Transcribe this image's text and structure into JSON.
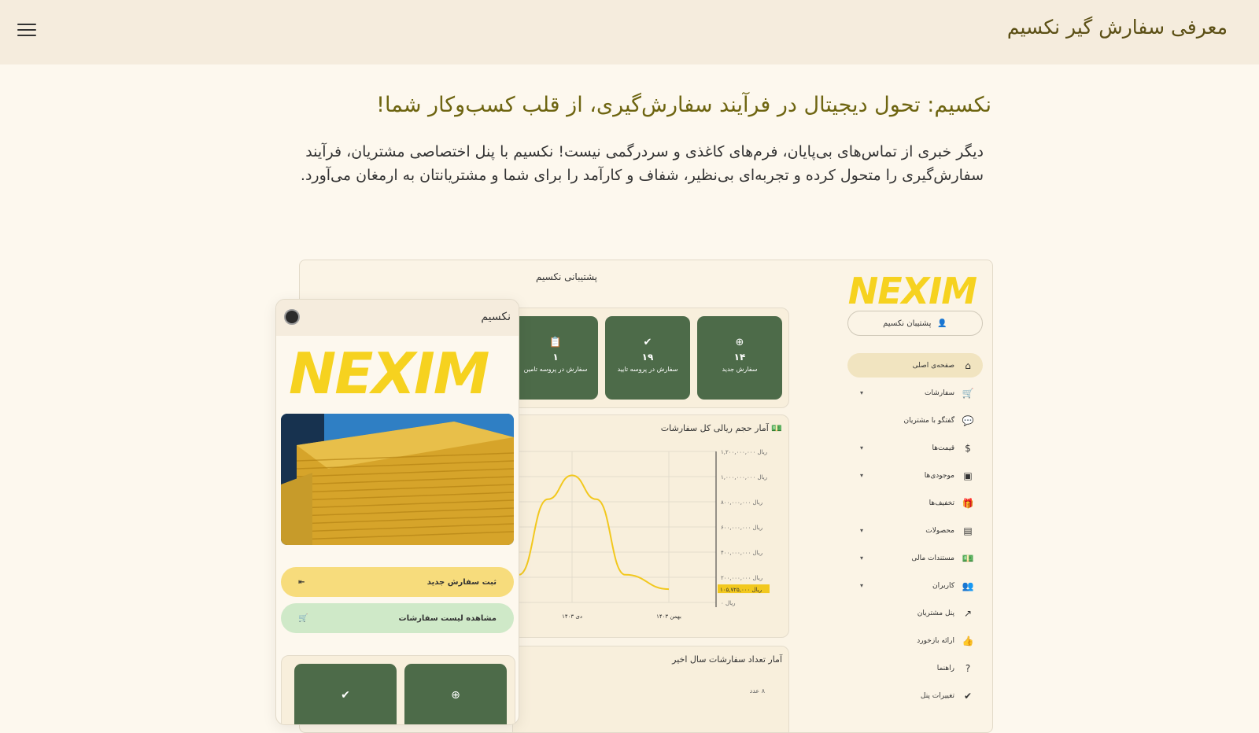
{
  "header": {
    "title": "معرفی سفارش گیر نکسیم",
    "menu_icon": "hamburger-icon"
  },
  "hero": {
    "title": "نکسیم: تحول دیجیتال در فرآیند سفارش‌گیری، از قلب کسب‌وکار شما!",
    "description": "دیگر خبری از تماس‌های بی‌پایان، فرم‌های کاغذی و سردرگمی نیست! نکسیم با پنل اختصاصی مشتریان، فرآیند سفارش‌گیری را متحول کرده و تجربه‌ای بی‌نظیر، شفاف و کارآمد را برای شما و مشتریانتان به ارمغان می‌آورد."
  },
  "dashboard": {
    "support_title": "پشتیبانی نکسیم",
    "logo": "NEXIM",
    "user_pill": "پشتیبان نکسیم",
    "sidebar": [
      {
        "label": "صفحه‌ی اصلی",
        "icon": "home-icon",
        "active": true,
        "caret": false
      },
      {
        "label": "سفارشات",
        "icon": "cart-icon",
        "active": false,
        "caret": true
      },
      {
        "label": "گفتگو با مشتریان",
        "icon": "chat-icon",
        "active": false,
        "caret": false
      },
      {
        "label": "قیمت‌ها",
        "icon": "dollar-icon",
        "active": false,
        "caret": true
      },
      {
        "label": "موجودی‌ها",
        "icon": "box-icon",
        "active": false,
        "caret": true
      },
      {
        "label": "تخفیف‌ها",
        "icon": "gift-icon",
        "active": false,
        "caret": false
      },
      {
        "label": "محصولات",
        "icon": "product-icon",
        "active": false,
        "caret": true
      },
      {
        "label": "مستندات مالی",
        "icon": "money-icon",
        "active": false,
        "caret": true
      },
      {
        "label": "کاربران",
        "icon": "users-icon",
        "active": false,
        "caret": true
      },
      {
        "label": "پنل مشتریان",
        "icon": "external-link-icon",
        "active": false,
        "caret": false
      },
      {
        "label": "ارائه بازخورد",
        "icon": "thumbs-up-icon",
        "active": false,
        "caret": false
      },
      {
        "label": "راهنما",
        "icon": "help-icon",
        "active": false,
        "caret": false
      },
      {
        "label": "تغییرات پنل",
        "icon": "check-badge-icon",
        "active": false,
        "caret": false
      }
    ],
    "stats": [
      {
        "value": "۱۴",
        "label": "سفارش جدید",
        "icon": "plus-circle-icon"
      },
      {
        "value": "۱۹",
        "label": "سفارش در پروسه تایید",
        "icon": "check-circle-icon"
      },
      {
        "value": "۱",
        "label": "سفارش در پروسه تامین",
        "icon": "clipboard-icon"
      }
    ],
    "chart_panel_title": "آمار حجم ریالی کل سفارشات",
    "chart_panel2_title": "آمار تعداد سفارشات سال اخیر",
    "panel2_tick": "۸ عدد"
  },
  "chart_data": {
    "type": "line",
    "title": "آمار حجم ریالی کل سفارشات",
    "x": [
      "دی ۱۴۰۳",
      "بهمن ۱۴۰۳"
    ],
    "y_tick_labels": [
      "ریال ۰",
      "ریال ۲۰۰,۰۰۰,۰۰۰",
      "ریال ۴۰۰,۰۰۰,۰۰۰",
      "ریال ۶۰۰,۰۰۰,۰۰۰",
      "ریال ۸۰۰,۰۰۰,۰۰۰",
      "ریال ۱,۰۰۰,۰۰۰,۰۰۰",
      "ریال ۱,۲۰۰,۰۰۰,۰۰۰"
    ],
    "highlight_label": "ریال ۱۰۵,۷۲۵,۰۰۰",
    "ylim": [
      0,
      1200000000
    ],
    "series": [
      {
        "color": "#f2c81e",
        "points": [
          [
            -0.55,
            220000000
          ],
          [
            -0.25,
            820000000
          ],
          [
            0.0,
            1010000000
          ],
          [
            0.25,
            820000000
          ],
          [
            0.55,
            220000000
          ],
          [
            1.0,
            105725000
          ]
        ]
      }
    ],
    "grid": true
  },
  "phone": {
    "title": "نکسیم",
    "logo": "NEXIM",
    "new_order_label": "ثبت سفارش جدید",
    "view_orders_label": "مشاهده لیست سفارشات",
    "cards": [
      {
        "icon": "plus-circle-icon"
      },
      {
        "icon": "check-circle-icon"
      }
    ]
  },
  "colors": {
    "accent_yellow": "#f6d21f",
    "card_green": "#4d6b49",
    "page_bg": "#fdf8ee",
    "topbar_bg": "#f5ecdd"
  }
}
